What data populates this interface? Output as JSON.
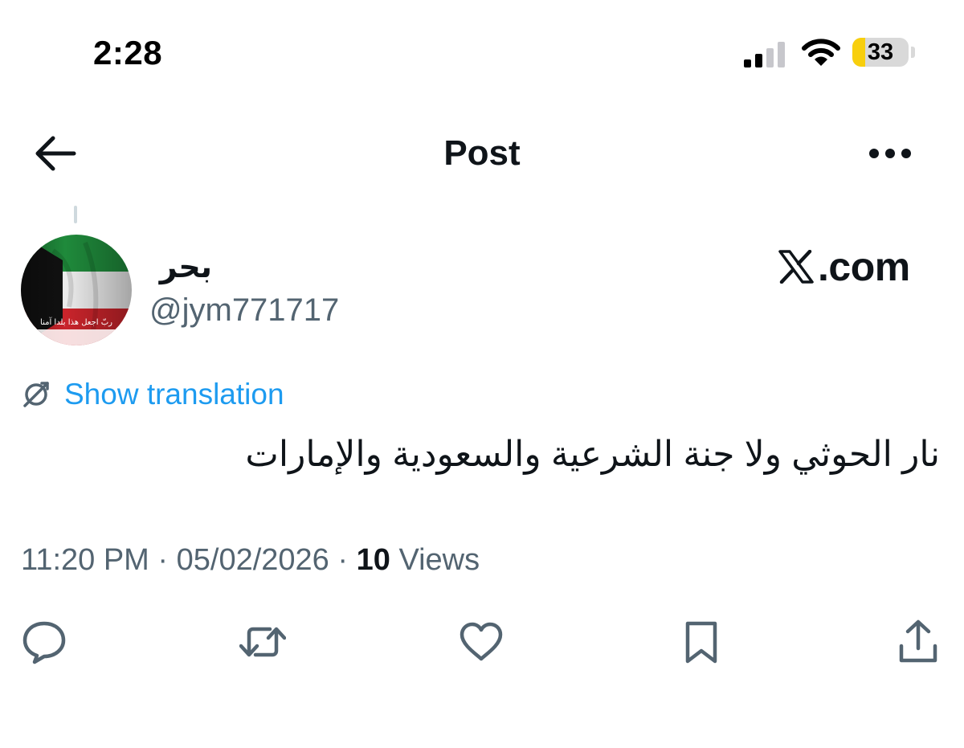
{
  "status_bar": {
    "time": "2:28",
    "battery_level": "33",
    "battery_fill_color": "#f8cf0d",
    "signal_icon": "cellular-signal-icon",
    "wifi_icon": "wifi-icon"
  },
  "header": {
    "title": "Post",
    "back_icon": "back-arrow-icon",
    "more_icon": "more-options-icon"
  },
  "post": {
    "author": {
      "display_name": "بحر",
      "handle": "@jym771717",
      "avatar_caption": "ربّ اجعل هذا بلدا آمنا"
    },
    "brand": {
      "logo_icon": "x-logo-icon",
      "text": ".com"
    },
    "translation_label": "Show translation",
    "text": "نار الحوثي ولا جنة الشرعية والسعودية والإمارات",
    "meta": {
      "time": "11:20 PM",
      "separator": "·",
      "date": "05/02/2026",
      "views_count": "10",
      "views_label": "Views"
    },
    "actions": [
      "reply-icon",
      "repost-icon",
      "like-icon",
      "bookmark-icon",
      "share-icon"
    ]
  },
  "colors": {
    "link": "#1d9bf0",
    "secondary_text": "#536471",
    "primary_text": "#0f1419",
    "icon": "#536471"
  }
}
